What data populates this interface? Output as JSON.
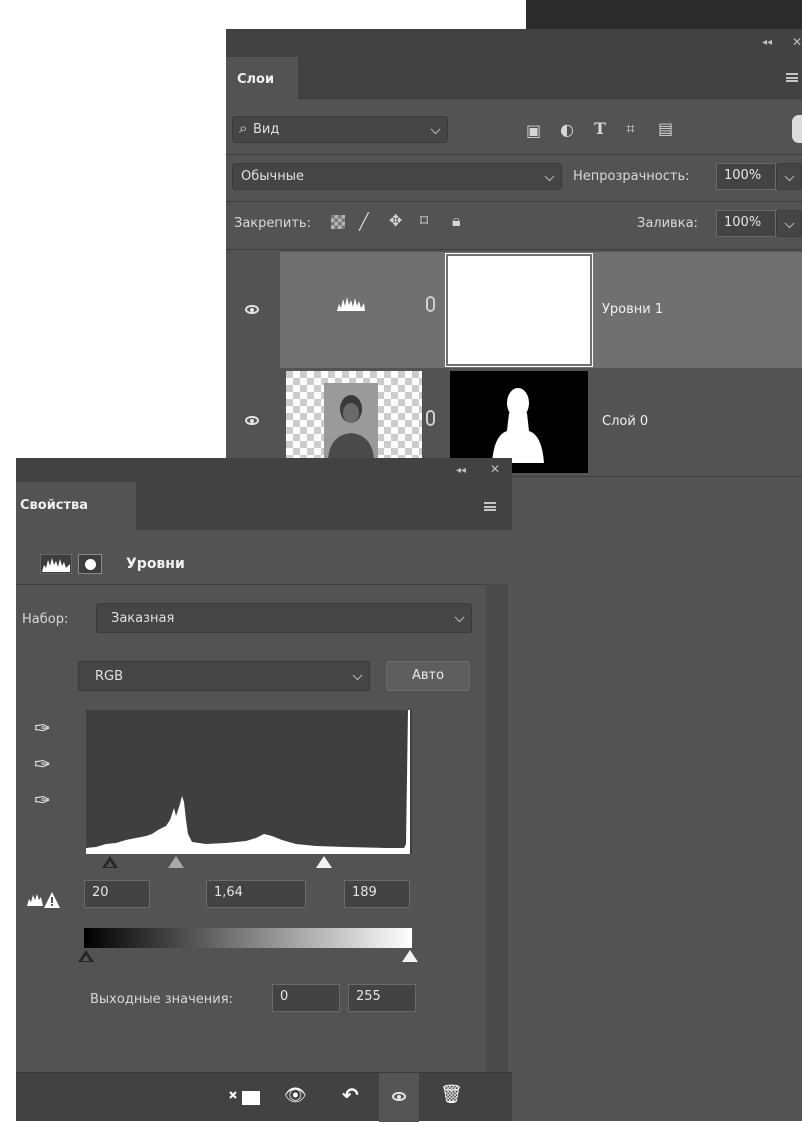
{
  "layers_panel": {
    "tab_label": "Слои",
    "filter": {
      "label": "Вид"
    },
    "blend_mode": "Обычные",
    "opacity_label": "Непрозрачность:",
    "opacity_value": "100%",
    "lock_label": "Закрепить:",
    "fill_label": "Заливка:",
    "fill_value": "100%",
    "layers": [
      {
        "name": "Уровни 1",
        "selected": true
      },
      {
        "name": "Слой 0",
        "selected": false
      }
    ]
  },
  "properties_panel": {
    "tab_label": "Свойства",
    "adjustment_title": "Уровни",
    "preset_label": "Набор:",
    "preset_value": "Заказная",
    "channel_value": "RGB",
    "auto_button": "Авто",
    "input_black": "20",
    "input_gamma": "1,64",
    "input_white": "189",
    "output_label": "Выходные значения:",
    "output_black": "0",
    "output_white": "255"
  },
  "colors": {
    "panel_bg": "#535353",
    "panel_header": "#424242",
    "selected_layer": "#707070"
  },
  "icons": [
    "search-icon",
    "image-filter-icon",
    "adjustment-filter-icon",
    "type-filter-icon",
    "shape-filter-icon",
    "smart-object-filter-icon",
    "lock-pixels-icon",
    "lock-brush-icon",
    "lock-move-icon",
    "lock-artboard-icon",
    "lock-all-icon",
    "eye-icon",
    "chain-icon",
    "histogram-icon",
    "mask-icon",
    "eyedropper-icon",
    "clip-icon",
    "view-previous-icon",
    "reset-icon",
    "trash-icon"
  ]
}
